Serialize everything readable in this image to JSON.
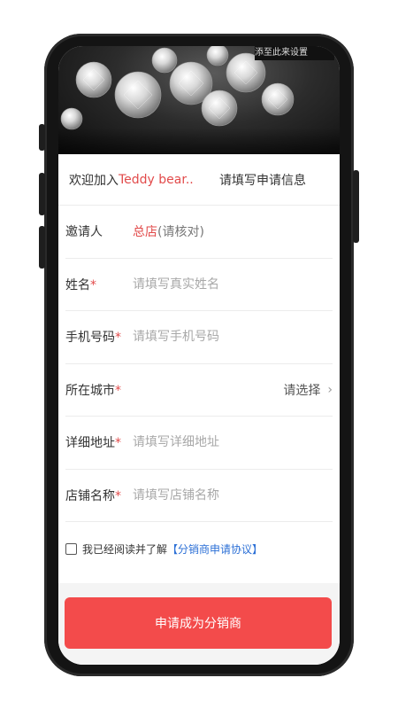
{
  "status_bar": {
    "partial_text": "添至此来设置"
  },
  "banner": {
    "image": "diamonds-banner"
  },
  "header": {
    "welcome_prefix": "欢迎加入",
    "brand_name": "Teddy bear...",
    "title": "请填写申请信息"
  },
  "fields": {
    "inviter": {
      "label": "邀请人",
      "value": "总店",
      "note": "(请核对)"
    },
    "name": {
      "label": "姓名",
      "required_mark": "*",
      "placeholder": "请填写真实姓名",
      "value": ""
    },
    "phone": {
      "label": "手机号码",
      "required_mark": "*",
      "placeholder": "请填写手机号码",
      "value": ""
    },
    "city": {
      "label": "所在城市",
      "required_mark": "*",
      "select_text": "请选择",
      "chevron": "›"
    },
    "address": {
      "label": "详细地址",
      "required_mark": "*",
      "placeholder": "请填写详细地址",
      "value": ""
    },
    "store": {
      "label": "店铺名称",
      "required_mark": "*",
      "placeholder": "请填写店铺名称",
      "value": ""
    }
  },
  "agreement": {
    "checked": false,
    "text": "我已经阅读并了解",
    "link_text": "【分销商申请协议】"
  },
  "submit": {
    "label": "申请成为分销商",
    "color": "#f34b4b"
  },
  "colors": {
    "accent_red": "#e24b4b",
    "link_blue": "#2b6fd6"
  }
}
